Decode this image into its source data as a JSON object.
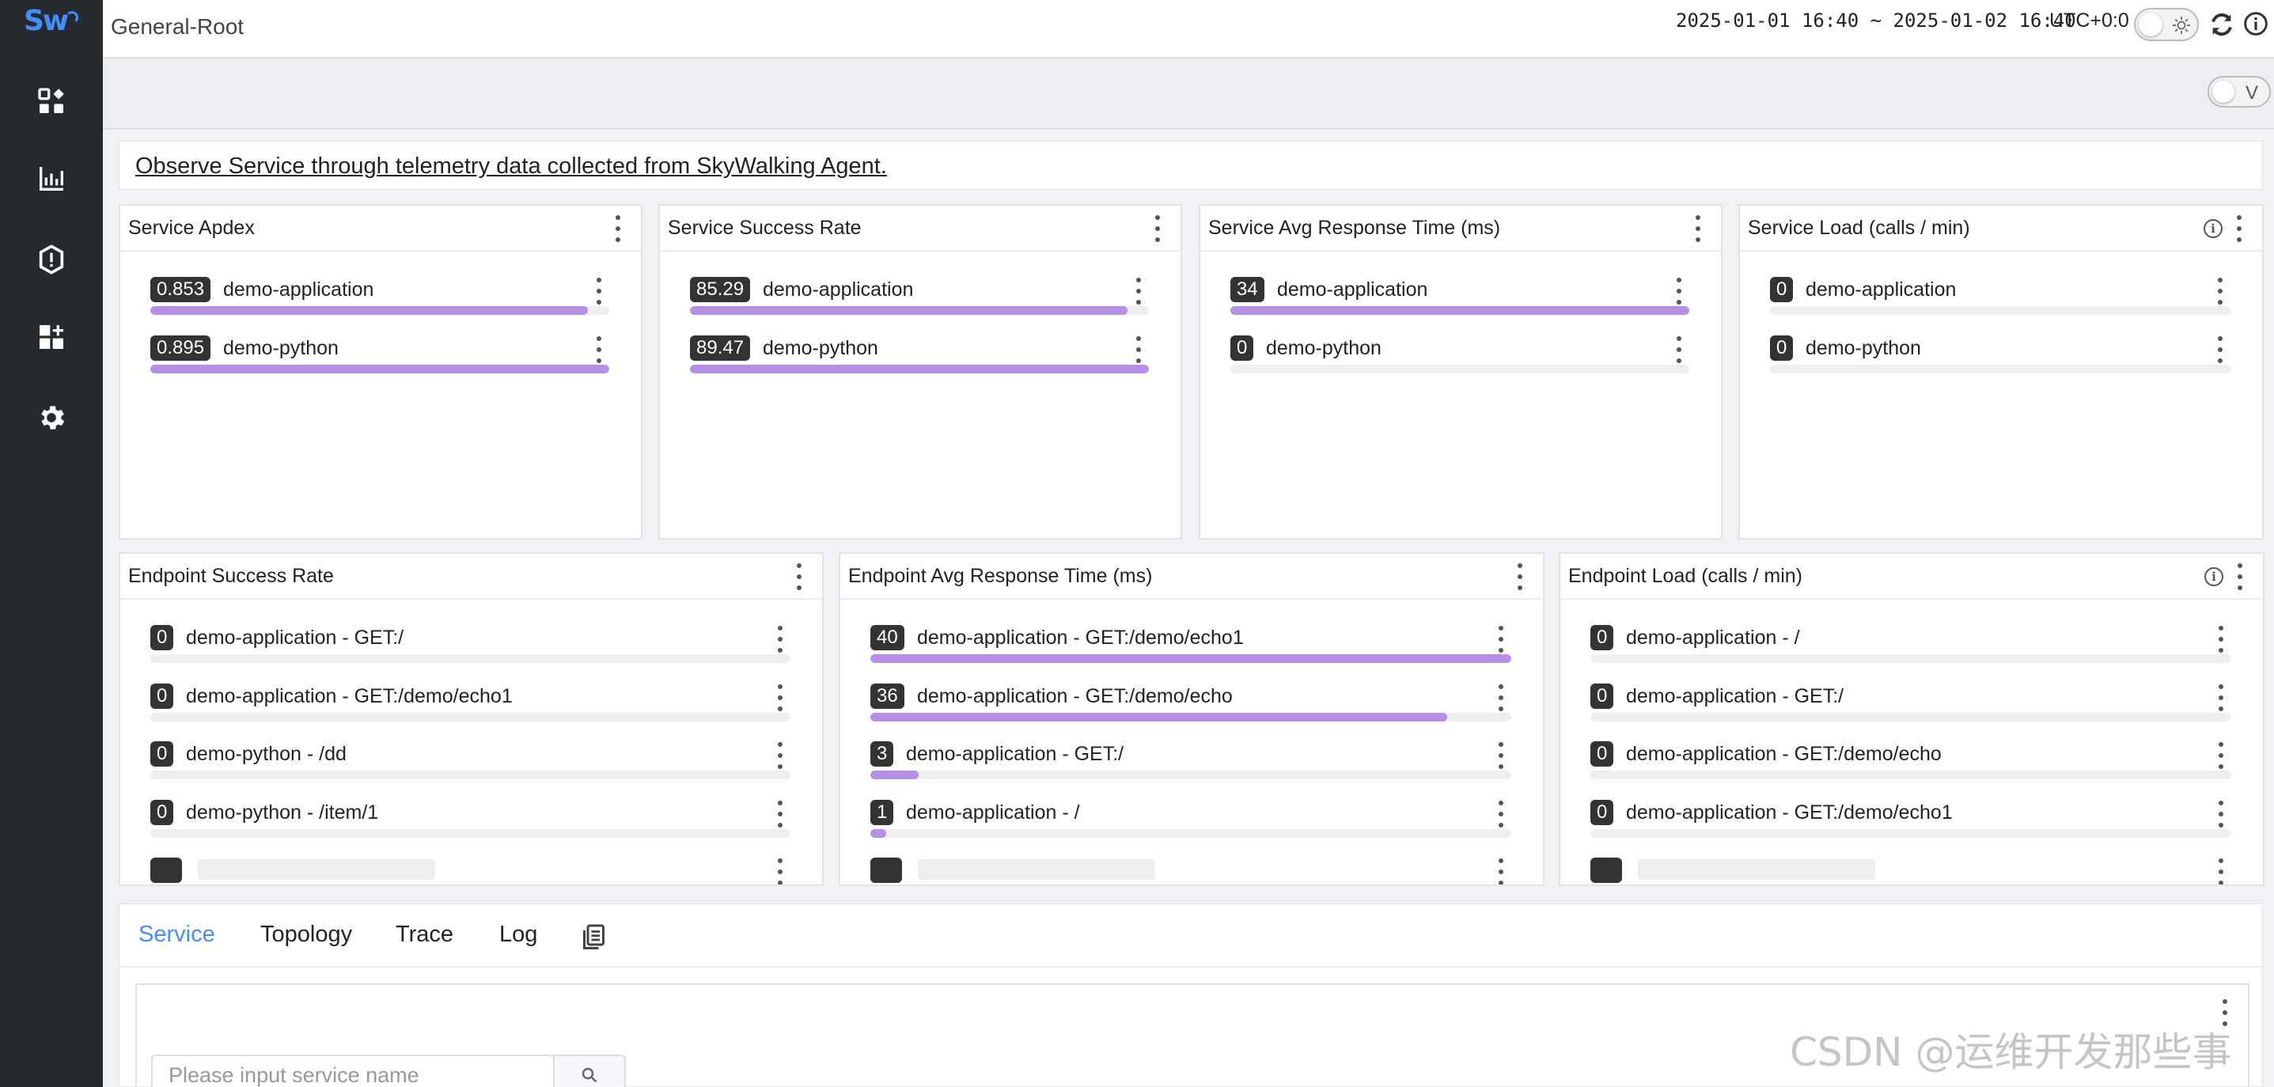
{
  "app": {
    "logo_text": "Sw"
  },
  "sidebar": {
    "items": [
      {
        "icon": "marketplace-icon"
      },
      {
        "icon": "dashboard-icon"
      },
      {
        "icon": "alarm-icon"
      },
      {
        "icon": "custom-dashboard-icon"
      },
      {
        "icon": "settings-icon"
      }
    ]
  },
  "header": {
    "breadcrumb": "General-Root",
    "time_range": "2025-01-01 16:40 ~ 2025-01-02 16:40",
    "timezone": "UTC+0:0"
  },
  "subbar": {
    "toggle_label": "V"
  },
  "intro": {
    "text": "Observe Service through telemetry data collected from SkyWalking Agent."
  },
  "widgets": [
    {
      "title": "Service Apdex",
      "info": false,
      "rows": [
        {
          "value": "0.853",
          "label": "demo-application",
          "level": 0.953
        },
        {
          "value": "0.895",
          "label": "demo-python",
          "level": 1.0
        }
      ]
    },
    {
      "title": "Service Success Rate",
      "info": false,
      "rows": [
        {
          "value": "85.29",
          "label": "demo-application",
          "level": 0.953
        },
        {
          "value": "89.47",
          "label": "demo-python",
          "level": 1.0
        }
      ]
    },
    {
      "title": "Service Avg Response Time (ms)",
      "info": false,
      "rows": [
        {
          "value": "34",
          "label": "demo-application",
          "level": 1.0
        },
        {
          "value": "0",
          "label": "demo-python",
          "level": 0
        }
      ]
    },
    {
      "title": "Service Load (calls / min)",
      "info": true,
      "rows": [
        {
          "value": "0",
          "label": "demo-application",
          "level": 0
        },
        {
          "value": "0",
          "label": "demo-python",
          "level": 0
        }
      ]
    },
    {
      "title": "Endpoint Success Rate",
      "info": false,
      "rows": [
        {
          "value": "0",
          "label": "demo-application - GET:/",
          "level": 0
        },
        {
          "value": "0",
          "label": "demo-application - GET:/demo/echo1",
          "level": 0
        },
        {
          "value": "0",
          "label": "demo-python - /dd",
          "level": 0
        },
        {
          "value": "0",
          "label": "demo-python - /item/1",
          "level": 0
        }
      ]
    },
    {
      "title": "Endpoint Avg Response Time (ms)",
      "info": false,
      "rows": [
        {
          "value": "40",
          "label": "demo-application - GET:/demo/echo1",
          "level": 1.0
        },
        {
          "value": "36",
          "label": "demo-application - GET:/demo/echo",
          "level": 0.9
        },
        {
          "value": "3",
          "label": "demo-application - GET:/",
          "level": 0.075
        },
        {
          "value": "1",
          "label": "demo-application - /",
          "level": 0.025
        }
      ]
    },
    {
      "title": "Endpoint Load (calls / min)",
      "info": true,
      "rows": [
        {
          "value": "0",
          "label": "demo-application - /",
          "level": 0
        },
        {
          "value": "0",
          "label": "demo-application - GET:/",
          "level": 0
        },
        {
          "value": "0",
          "label": "demo-application - GET:/demo/echo",
          "level": 0
        },
        {
          "value": "0",
          "label": "demo-application - GET:/demo/echo1",
          "level": 0
        }
      ]
    }
  ],
  "tabs": [
    "Service",
    "Topology",
    "Trace",
    "Log"
  ],
  "active_tab": "Service",
  "search": {
    "placeholder": "Please input service name"
  },
  "watermark": "CSDN @运维开发那些事",
  "colors": {
    "sidebar": "#252a2f",
    "accent": "#448dfe",
    "bar": "#b590e6",
    "badge": "#333333"
  }
}
